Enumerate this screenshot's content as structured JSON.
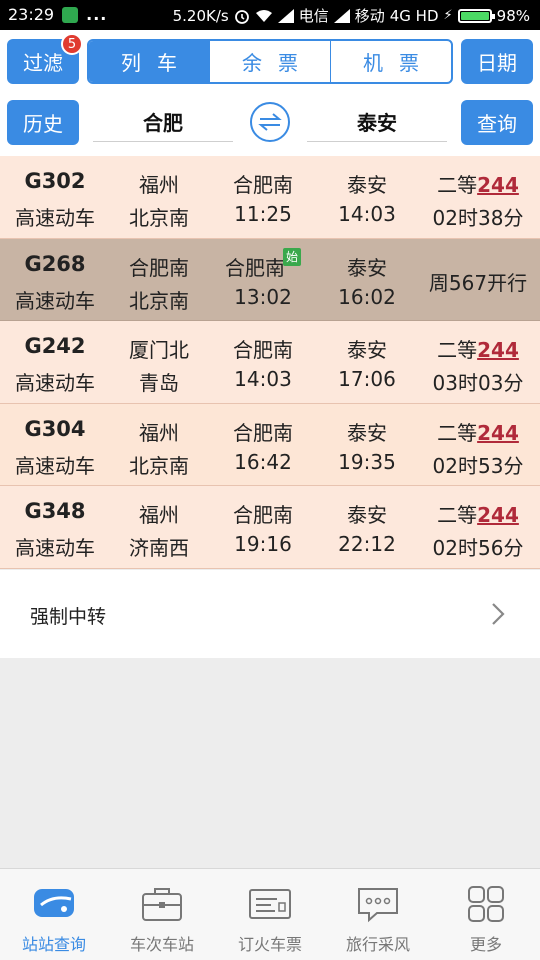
{
  "status_bar": {
    "time": "23:29",
    "dots": "...",
    "speed": "5.20K/s",
    "carrier1": "电信",
    "carrier2": "移动",
    "network": "4G HD",
    "battery": "98%"
  },
  "toolbar": {
    "filter_label": "过滤",
    "filter_badge": "5",
    "tabs": [
      "列车",
      "余票",
      "机票"
    ],
    "date_label": "日期",
    "history_label": "历史",
    "from_station": "合肥",
    "to_station": "泰安",
    "query_label": "查询"
  },
  "trains": [
    {
      "no": "G302",
      "type": "高速动车",
      "start": "福州",
      "end": "北京南",
      "from": "合肥南",
      "depart": "11:25",
      "to": "泰安",
      "arrive": "14:03",
      "seat": "二等",
      "price": "244",
      "duration": "02时38分"
    },
    {
      "no": "G268",
      "type": "高速动车",
      "start": "合肥南",
      "end": "北京南",
      "from": "合肥南",
      "from_tag": "始",
      "depart": "13:02",
      "to": "泰安",
      "arrive": "16:02",
      "schedule": "周567开行"
    },
    {
      "no": "G242",
      "type": "高速动车",
      "start": "厦门北",
      "end": "青岛",
      "from": "合肥南",
      "depart": "14:03",
      "to": "泰安",
      "arrive": "17:06",
      "seat": "二等",
      "price": "244",
      "duration": "03时03分"
    },
    {
      "no": "G304",
      "type": "高速动车",
      "start": "福州",
      "end": "北京南",
      "from": "合肥南",
      "depart": "16:42",
      "to": "泰安",
      "arrive": "19:35",
      "seat": "二等",
      "price": "244",
      "duration": "02时53分"
    },
    {
      "no": "G348",
      "type": "高速动车",
      "start": "福州",
      "end": "济南西",
      "from": "合肥南",
      "depart": "19:16",
      "to": "泰安",
      "arrive": "22:12",
      "seat": "二等",
      "price": "244",
      "duration": "02时56分"
    }
  ],
  "transfer": {
    "label": "强制中转"
  },
  "nav": {
    "items": [
      {
        "label": "站站查询",
        "icon": "train-icon"
      },
      {
        "label": "车次车站",
        "icon": "briefcase-icon"
      },
      {
        "label": "订火车票",
        "icon": "ticket-icon"
      },
      {
        "label": "旅行采风",
        "icon": "chat-icon"
      },
      {
        "label": "更多",
        "icon": "grid-icon"
      }
    ]
  },
  "colors": {
    "accent": "#3a8be3",
    "row_bg": "#fde8dc",
    "row_disabled_bg": "#c8b4a4",
    "price": "#b02a3a",
    "badge": "#e03b30"
  }
}
